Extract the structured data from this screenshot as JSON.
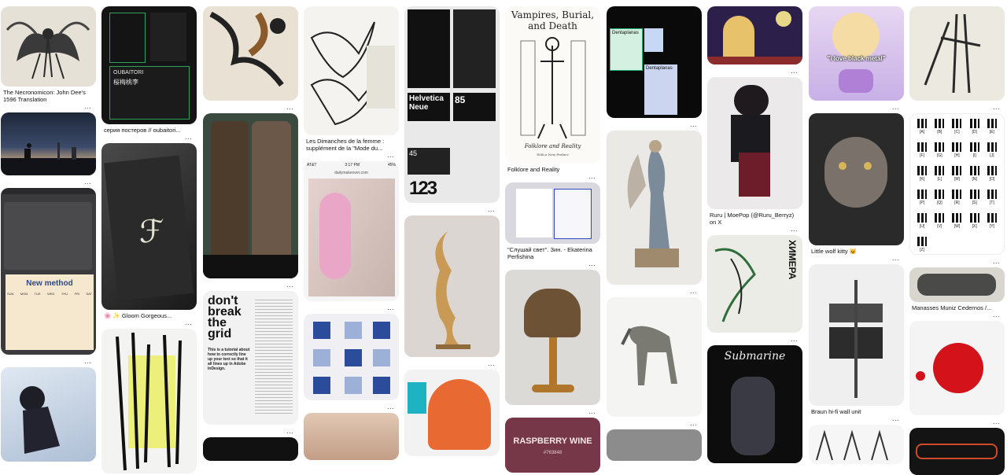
{
  "more_label": "...",
  "pins": {
    "necronomicon": {
      "title": "The Necronomicon: John Dee's 1596 Translation"
    },
    "oubaitori": {
      "title": "серия постеров // oubaitori...",
      "poster_heading": "OUBAITORI",
      "poster_kanji": "桜梅桃李"
    },
    "gloom": {
      "title": "🌸 ✨ Gloom Gorgeous..."
    },
    "dimanches": {
      "title": "Les Dimanches de la femme : supplément de la \"Mode du..."
    },
    "phone": {
      "carrier": "AT&T",
      "time": "3:17 PM",
      "battery": "45%",
      "url": "dailymakeover.com"
    },
    "indesign": {
      "headline": "New method",
      "days": [
        "SUN",
        "MON",
        "TUE",
        "WED",
        "THU",
        "FRI",
        "SAT"
      ]
    },
    "vampires": {
      "title": "Folklore and Reality",
      "book_title": "Vampires, Burial, and Death",
      "book_subtitle": "Folklore and Reality",
      "book_note": "With a New Preface"
    },
    "slushai": {
      "title": "\"Слушай свет\". Зин. - Ekaterina Perfishina"
    },
    "helvetica": {
      "label": "Helvetica Neue",
      "number": "85",
      "number2": "45"
    },
    "dentaplanas": {
      "brand": "Dentaplanas"
    },
    "ruru": {
      "title": "Ruru | MoePop (@Ruru_Berryz) on X"
    },
    "i_love": {
      "caption": "\"i love black metal\""
    },
    "wolf_kitty": {
      "title": "Little wolf kitty 😺"
    },
    "braun": {
      "title": "Braun hi-fi wall unit"
    },
    "manasses": {
      "title": "Manasses Muniz Cedernos /..."
    },
    "raspberry": {
      "label": "RASPBERRY WINE",
      "hex": "#763848"
    },
    "submarine": {
      "title_word": "Submarine"
    },
    "khimera": {
      "word": "ХИМЕРА"
    },
    "grid_book": {
      "headline": "don't break the grid",
      "body": "This is a tutorial about how to correctly line up your text so that it all lines up in Adobe InDesign."
    },
    "morse": {
      "letters": [
        "[A]",
        "[B]",
        "[C]",
        "[D]",
        "[E]",
        "[F]",
        "[G]",
        "[H]",
        "[I]",
        "[J]",
        "[K]",
        "[L]",
        "[M]",
        "[N]",
        "[O]",
        "[P]",
        "[Q]",
        "[R]",
        "[S]",
        "[T]",
        "[U]",
        "[V]",
        "[W]",
        "[X]",
        "[Y]",
        "[Z]"
      ]
    }
  }
}
